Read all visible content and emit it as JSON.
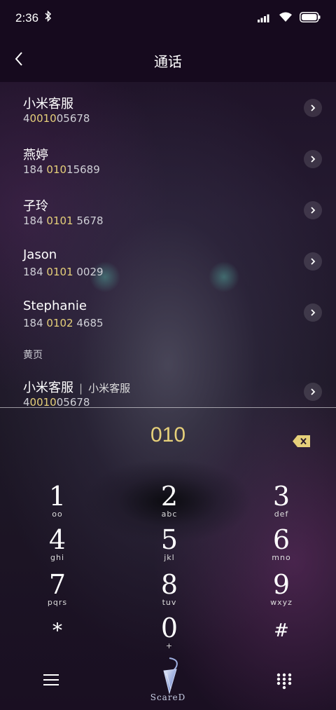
{
  "status": {
    "time": "2:36"
  },
  "header": {
    "title": "通话"
  },
  "contacts": [
    {
      "name": "小米客服",
      "num_pre": "4",
      "num_hl": "0010",
      "num_post": "05678"
    },
    {
      "name": "燕婷",
      "num_pre": "184 ",
      "num_hl": "010",
      "num_post": "15689"
    },
    {
      "name": "子玲",
      "num_pre": "184 ",
      "num_hl": "0101",
      "num_post": " 5678"
    },
    {
      "name": "Jason",
      "num_pre": "184 ",
      "num_hl": "0101",
      "num_post": " 0029"
    },
    {
      "name": "Stephanie",
      "num_pre": "184 ",
      "num_hl": "0102",
      "num_post": " 4685"
    }
  ],
  "yellow_pages": {
    "section_label": "黄页",
    "item": {
      "name": "小米客服",
      "separator": "|",
      "subtitle": "小米客服",
      "num_pre": "4",
      "num_hl": "0010",
      "num_post": "05678"
    }
  },
  "dialpad": {
    "dialed_number": "010",
    "keys": [
      {
        "digit": "1",
        "letters": "ᴏᴏ"
      },
      {
        "digit": "2",
        "letters": "abc"
      },
      {
        "digit": "3",
        "letters": "def"
      },
      {
        "digit": "4",
        "letters": "ghi"
      },
      {
        "digit": "5",
        "letters": "jkl"
      },
      {
        "digit": "6",
        "letters": "mno"
      },
      {
        "digit": "7",
        "letters": "pqrs"
      },
      {
        "digit": "8",
        "letters": "tuv"
      },
      {
        "digit": "9",
        "letters": "wxyz"
      },
      {
        "digit": "*",
        "letters": ""
      },
      {
        "digit": "0",
        "letters": "+"
      },
      {
        "digit": "#",
        "letters": ""
      }
    ]
  },
  "bottom_bar": {
    "logo_text": "ScareD"
  },
  "colors": {
    "highlight": "#e6d07a",
    "bar_bg": "#160a1e"
  }
}
